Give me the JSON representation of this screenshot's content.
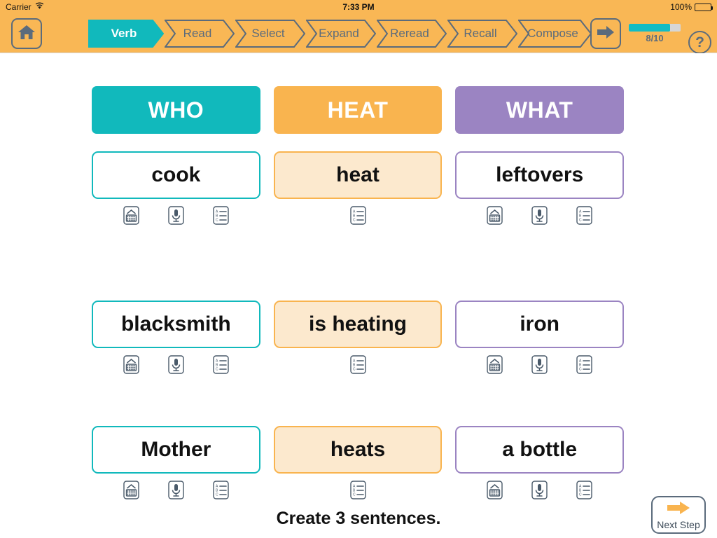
{
  "status_bar": {
    "carrier": "Carrier",
    "wifi_icon": "wifi-icon",
    "time": "7:33 PM",
    "battery_percent": "100%",
    "battery_icon": "battery-full-icon"
  },
  "top_bar": {
    "background_color": "#F9B755",
    "home_icon": "home-icon",
    "forward_icon": "arrow-right-icon",
    "help_label": "?",
    "progress": {
      "label": "8/10",
      "current": 8,
      "total": 10,
      "percent": 80,
      "fill_color": "#13BCC4",
      "track_color": "#d6d6d6"
    },
    "breadcrumb": [
      {
        "label": "Verb",
        "active": true
      },
      {
        "label": "Read",
        "active": false
      },
      {
        "label": "Select",
        "active": false
      },
      {
        "label": "Expand",
        "active": false
      },
      {
        "label": "Reread",
        "active": false
      },
      {
        "label": "Recall",
        "active": false
      },
      {
        "label": "Compose",
        "active": false
      }
    ]
  },
  "columns": [
    {
      "header": "WHO",
      "color": "#11B9BC",
      "card_fill": "#ffffff",
      "words": [
        {
          "text": "cook",
          "icons": [
            "keyboard-icon",
            "microphone-icon",
            "list-options-icon"
          ]
        },
        {
          "text": "blacksmith",
          "icons": [
            "keyboard-icon",
            "microphone-icon",
            "list-options-icon"
          ]
        },
        {
          "text": "Mother",
          "icons": [
            "keyboard-icon",
            "microphone-icon",
            "list-options-icon"
          ]
        }
      ]
    },
    {
      "header": "HEAT",
      "color": "#F9B44F",
      "card_fill": "#FCE9CE",
      "words": [
        {
          "text": "heat",
          "icons": [
            "list-options-icon"
          ]
        },
        {
          "text": "is heating",
          "icons": [
            "list-options-icon"
          ]
        },
        {
          "text": "heats",
          "icons": [
            "list-options-icon"
          ]
        }
      ]
    },
    {
      "header": "WHAT",
      "color": "#9B84C2",
      "card_fill": "#ffffff",
      "words": [
        {
          "text": "leftovers",
          "icons": [
            "keyboard-icon",
            "microphone-icon",
            "list-options-icon"
          ]
        },
        {
          "text": "iron",
          "icons": [
            "keyboard-icon",
            "microphone-icon",
            "list-options-icon"
          ]
        },
        {
          "text": "a bottle",
          "icons": [
            "keyboard-icon",
            "microphone-icon",
            "list-options-icon"
          ]
        }
      ]
    }
  ],
  "footer": {
    "instruction": "Create 3 sentences.",
    "next_step_label": "Next Step",
    "next_step_icon": "arrow-right-icon",
    "next_step_arrow_color": "#F9B44F"
  }
}
